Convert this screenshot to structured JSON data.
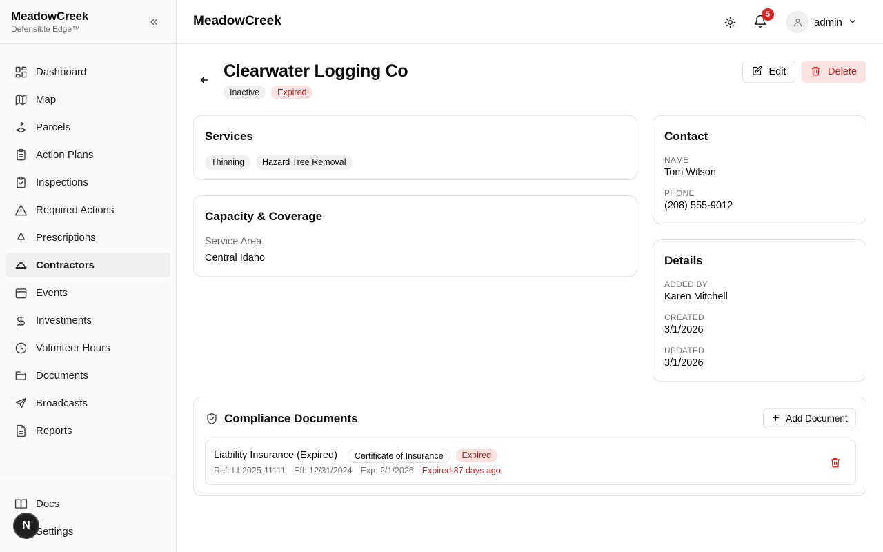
{
  "app": {
    "brand_name": "MeadowCreek",
    "brand_sub": "Defensible Edge™",
    "header_title": "MeadowCreek",
    "notification_count": "5",
    "user_name": "admin"
  },
  "sidebar": {
    "items": [
      {
        "label": "Dashboard",
        "icon": "dashboard-icon"
      },
      {
        "label": "Map",
        "icon": "map-icon"
      },
      {
        "label": "Parcels",
        "icon": "parcels-icon"
      },
      {
        "label": "Action Plans",
        "icon": "clipboard-list-icon"
      },
      {
        "label": "Inspections",
        "icon": "clipboard-check-icon"
      },
      {
        "label": "Required Actions",
        "icon": "alert-triangle-icon"
      },
      {
        "label": "Prescriptions",
        "icon": "tree-icon"
      },
      {
        "label": "Contractors",
        "icon": "hard-hat-icon",
        "active": true
      },
      {
        "label": "Events",
        "icon": "calendar-icon"
      },
      {
        "label": "Investments",
        "icon": "dollar-icon"
      },
      {
        "label": "Volunteer Hours",
        "icon": "clock-icon"
      },
      {
        "label": "Documents",
        "icon": "folder-icon"
      },
      {
        "label": "Broadcasts",
        "icon": "send-icon"
      },
      {
        "label": "Reports",
        "icon": "file-text-icon"
      }
    ],
    "bottom_items": [
      {
        "label": "Docs",
        "icon": "book-icon"
      },
      {
        "label": "Settings",
        "icon": "settings-icon"
      }
    ],
    "floating_avatar": "N"
  },
  "contractor": {
    "name": "Clearwater Logging Co",
    "status_badges": [
      "Inactive",
      "Expired"
    ],
    "edit_label": "Edit",
    "delete_label": "Delete"
  },
  "services": {
    "title": "Services",
    "items": [
      "Thinning",
      "Hazard Tree Removal"
    ]
  },
  "capacity": {
    "title": "Capacity & Coverage",
    "service_area_label": "Service Area",
    "service_area_value": "Central Idaho"
  },
  "contact": {
    "title": "Contact",
    "name_label": "NAME",
    "name_value": "Tom Wilson",
    "phone_label": "PHONE",
    "phone_value": "(208) 555-9012"
  },
  "details": {
    "title": "Details",
    "added_by_label": "ADDED BY",
    "added_by_value": "Karen Mitchell",
    "created_label": "CREATED",
    "created_value": "3/1/2026",
    "updated_label": "UPDATED",
    "updated_value": "3/1/2026"
  },
  "compliance": {
    "title": "Compliance Documents",
    "add_label": "Add Document",
    "documents": [
      {
        "name": "Liability Insurance (Expired)",
        "type": "Certificate of Insurance",
        "status": "Expired",
        "ref": "Ref: LI-2025-11111",
        "eff": "Eff: 12/31/2024",
        "exp": "Exp: 2/1/2026",
        "note": "Expired 87 days ago"
      }
    ]
  },
  "colors": {
    "danger": "#dc2626",
    "danger_bg": "#fde2e2",
    "active_nav_bg": "#f0f0f0"
  }
}
